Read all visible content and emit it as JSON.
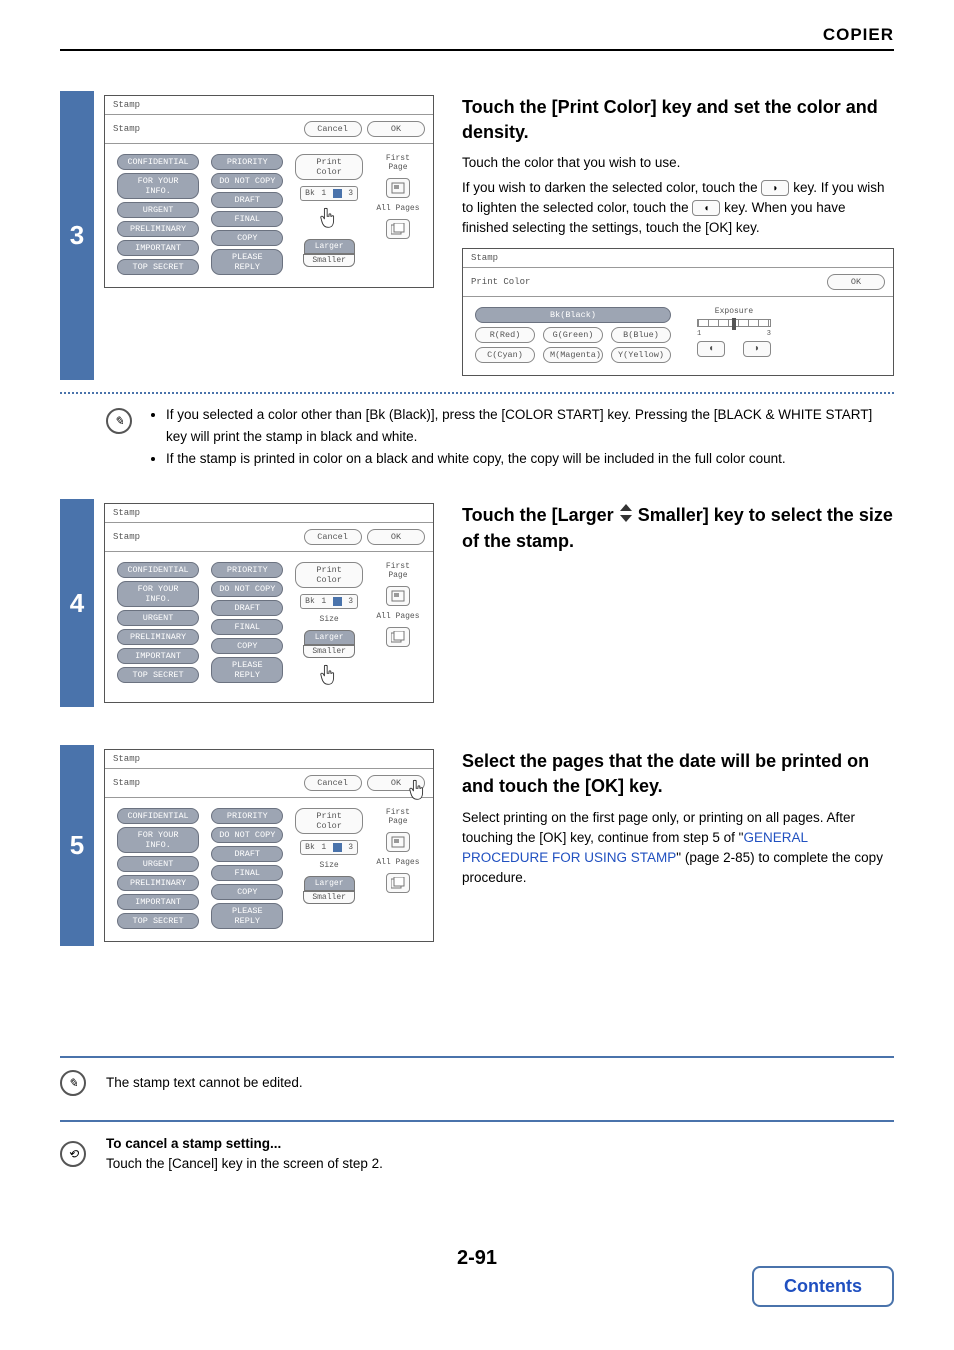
{
  "header": "COPIER",
  "steps": {
    "s3": {
      "num": "3",
      "title": "Touch the [Print Color] key and set the color and density.",
      "para1": "Touch the color that you wish to use.",
      "para2a": "If you wish to darken the selected color, touch the ",
      "para2b": " key. If you wish to lighten the selected color, touch the ",
      "para2c": " key. When you have finished selecting the settings, touch the [OK] key.",
      "panel": {
        "title": "Stamp",
        "sub": "Stamp",
        "cancel": "Cancel",
        "ok": "OK",
        "stamps_left": [
          "CONFIDENTIAL",
          "FOR YOUR INFO.",
          "URGENT",
          "PRELIMINARY",
          "IMPORTANT",
          "TOP SECRET"
        ],
        "stamps_right": [
          "PRIORITY",
          "DO NOT COPY",
          "DRAFT",
          "FINAL",
          "COPY",
          "PLEASE REPLY"
        ],
        "print_color": "Print Color",
        "bk": "Bk",
        "one": "1",
        "three": "3",
        "first_page": "First Page",
        "all_pages": "All Pages",
        "larger": "Larger",
        "smaller": "Smaller"
      },
      "color_panel": {
        "title": "Stamp",
        "sub": "Print Color",
        "ok": "OK",
        "bk": "Bk(Black)",
        "r": "R(Red)",
        "g": "G(Green)",
        "b": "B(Blue)",
        "c": "C(Cyan)",
        "m": "M(Magenta)",
        "y": "Y(Yellow)",
        "exposure": "Exposure",
        "e1": "1",
        "e3": "3"
      },
      "notes": [
        "If you selected a color other than [Bk (Black)], press the [COLOR START] key. Pressing the [BLACK & WHITE START] key will print the stamp in black and white.",
        "If the stamp is printed in color on a black and white copy, the copy will be included in the full color count."
      ]
    },
    "s4": {
      "num": "4",
      "title_a": "Touch the [Larger",
      "title_b": "Smaller] key to select the size of the stamp.",
      "panel": {
        "title": "Stamp",
        "sub": "Stamp",
        "cancel": "Cancel",
        "ok": "OK",
        "stamps_left": [
          "CONFIDENTIAL",
          "FOR YOUR INFO.",
          "URGENT",
          "PRELIMINARY",
          "IMPORTANT",
          "TOP SECRET"
        ],
        "stamps_right": [
          "PRIORITY",
          "DO NOT COPY",
          "DRAFT",
          "FINAL",
          "COPY",
          "PLEASE REPLY"
        ],
        "print_color": "Print Color",
        "bk": "Bk",
        "one": "1",
        "three": "3",
        "first_page": "First Page",
        "all_pages": "All Pages",
        "size": "Size",
        "larger": "Larger",
        "smaller": "Smaller"
      }
    },
    "s5": {
      "num": "5",
      "title": "Select the pages that the date will be printed on and touch the [OK] key.",
      "para_a": "Select printing on the first page only, or printing on all pages. After touching the [OK] key, continue from step 5 of \"",
      "link": "GENERAL PROCEDURE FOR USING STAMP",
      "para_b": "\" (page 2-85) to complete the copy procedure.",
      "panel": {
        "title": "Stamp",
        "sub": "Stamp",
        "cancel": "Cancel",
        "ok": "OK",
        "stamps_left": [
          "CONFIDENTIAL",
          "FOR YOUR INFO.",
          "URGENT",
          "PRELIMINARY",
          "IMPORTANT",
          "TOP SECRET"
        ],
        "stamps_right": [
          "PRIORITY",
          "DO NOT COPY",
          "DRAFT",
          "FINAL",
          "COPY",
          "PLEASE REPLY"
        ],
        "print_color": "Print Color",
        "bk": "Bk",
        "one": "1",
        "three": "3",
        "first_page": "First Page",
        "all_pages": "All Pages",
        "size": "Size",
        "larger": "Larger",
        "smaller": "Smaller"
      }
    }
  },
  "footer_notes": {
    "n1": "The stamp text cannot be edited.",
    "n2_bold": "To cancel a stamp setting...",
    "n2": "Touch the [Cancel] key in the screen of step 2."
  },
  "page_number": "2-91",
  "contents": "Contents"
}
